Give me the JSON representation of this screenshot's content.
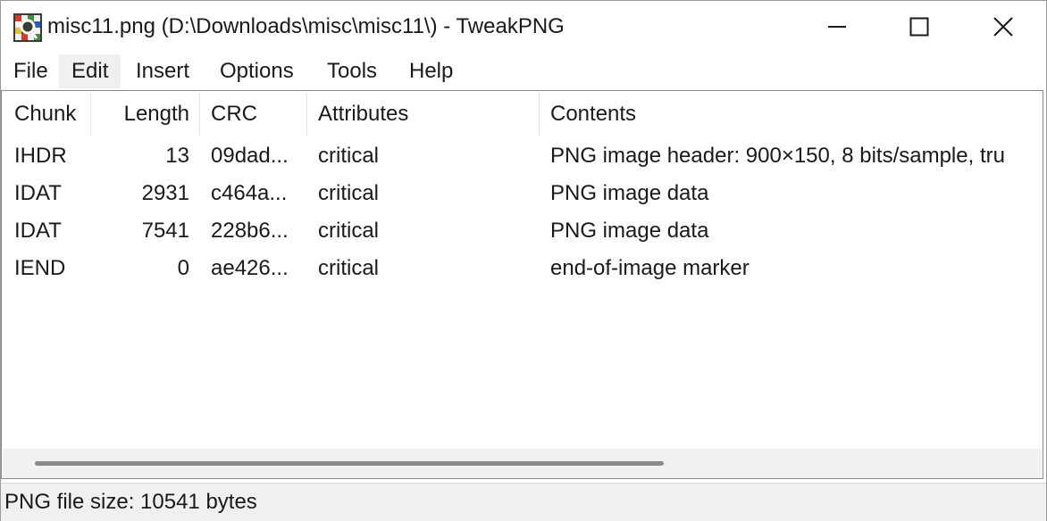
{
  "window": {
    "title": "misc11.png (D:\\Downloads\\misc\\misc11\\) - TweakPNG",
    "icon": "tweakpng-app-icon"
  },
  "caption_buttons": {
    "minimize_icon": "minimize-icon",
    "maximize_icon": "maximize-icon",
    "close_icon": "close-icon"
  },
  "menu": {
    "items": [
      {
        "label": "File"
      },
      {
        "label": "Edit"
      },
      {
        "label": "Insert"
      },
      {
        "label": "Options"
      },
      {
        "label": "Tools"
      },
      {
        "label": "Help"
      }
    ]
  },
  "table": {
    "columns": [
      "Chunk",
      "Length",
      "CRC",
      "Attributes",
      "Contents"
    ],
    "rows": [
      {
        "chunk": "IHDR",
        "length": "13",
        "crc": "09dad...",
        "attributes": "critical",
        "contents": "PNG image header: 900×150, 8 bits/sample, tru"
      },
      {
        "chunk": "IDAT",
        "length": "2931",
        "crc": "c464a...",
        "attributes": "critical",
        "contents": "PNG image data"
      },
      {
        "chunk": "IDAT",
        "length": "7541",
        "crc": "228b6...",
        "attributes": "critical",
        "contents": "PNG image data"
      },
      {
        "chunk": "IEND",
        "length": "0",
        "crc": "ae426...",
        "attributes": "critical",
        "contents": "end-of-image marker"
      }
    ]
  },
  "status": {
    "text": "PNG file size: 10541 bytes"
  }
}
